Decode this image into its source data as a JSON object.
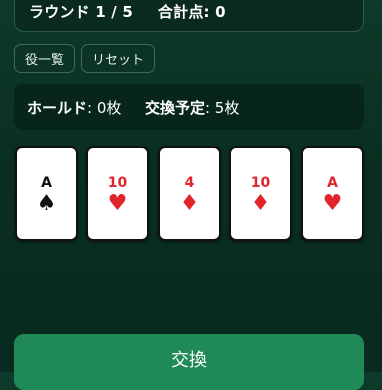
{
  "header": {
    "round_label": "ラウンド",
    "round_value": "1 / 5",
    "total_label": "合計点:",
    "total_value": "0"
  },
  "buttons": {
    "list_label": "役一覧",
    "reset_label": "リセット",
    "exchange_label": "交換"
  },
  "status": {
    "hold_label": "ホールド",
    "hold_value": ": 0枚",
    "exchange_label": "交換予定",
    "exchange_value": ": 5枚"
  },
  "cards": [
    {
      "rank": "A",
      "suit": "♠",
      "color": "#111111"
    },
    {
      "rank": "10",
      "suit": "♥",
      "color": "#e0262b"
    },
    {
      "rank": "4",
      "suit": "♦",
      "color": "#e0262b"
    },
    {
      "rank": "10",
      "suit": "♦",
      "color": "#e0262b"
    },
    {
      "rank": "A",
      "suit": "♥",
      "color": "#e0262b"
    }
  ],
  "colors": {
    "background": "#0a2f22",
    "accent_button": "#1f8a55",
    "red_suit": "#e0262b",
    "black_suit": "#111111"
  }
}
